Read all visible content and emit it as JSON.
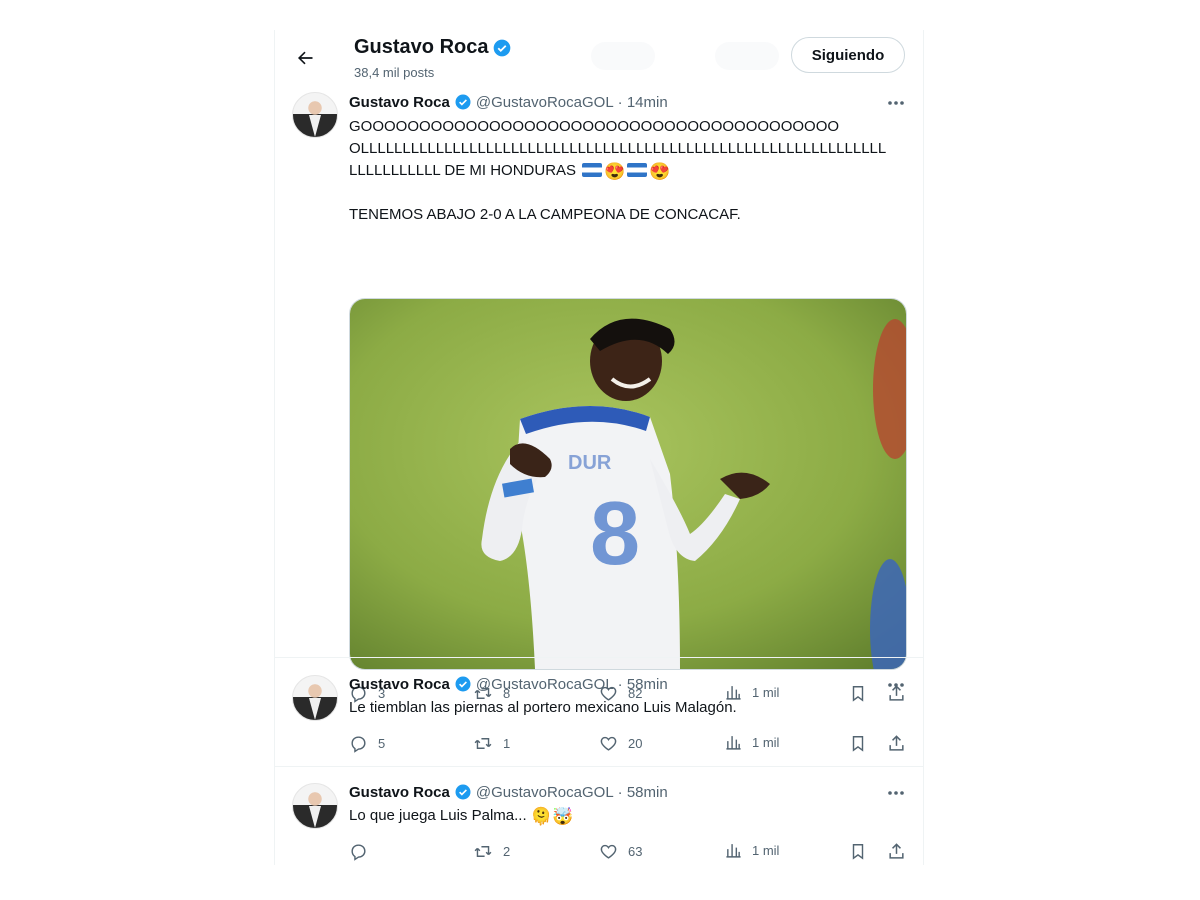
{
  "header": {
    "title": "Gustavo Roca",
    "subtitle": "38,4 mil posts",
    "follow_label": "Siguiendo"
  },
  "colors": {
    "accent": "#1d9bf0",
    "text_secondary": "#536471",
    "honduras_blue": "#2f74c7",
    "pitch_green": "#8fb54a"
  },
  "tweets": [
    {
      "name": "Gustavo Roca",
      "handle": "@GustavoRocaGOL",
      "time": "· 14min",
      "lines": [
        "GOOOOOOOOOOOOOOOOOOOOOOOOOOOOOOOOOOOOOOOOO",
        "OLLLLLLLLLLLLLLLLLLLLLLLLLLLLLLLLLLLLLLLLLLLLLLLLLLLLLLLLLLLLLLL",
        "LLLLLLLLLLL DE MI HONDURAS",
        "",
        "TENEMOS ABAJO 2-0 A LA CAMPEONA DE CONCACAF."
      ],
      "emojis": [
        "🇭🇳",
        "😍",
        "🇭🇳",
        "😍"
      ],
      "media_description": "Jugador de Honduras número 8 celebrando",
      "replies": "3",
      "reposts": "8",
      "likes": "82",
      "views": "1 mil"
    },
    {
      "name": "Gustavo Roca",
      "handle": "@GustavoRocaGOL",
      "time": "· 58min",
      "lines": [
        "Le tiemblan las piernas al portero mexicano Luis Malagón."
      ],
      "replies": "5",
      "reposts": "1",
      "likes": "20",
      "views": "1 mil"
    },
    {
      "name": "Gustavo Roca",
      "handle": "@GustavoRocaGOL",
      "time": "· 58min",
      "lines": [
        "Lo que juega Luis Palma..."
      ],
      "emojis": [
        "🫠",
        "🤯"
      ],
      "replies": "",
      "reposts": "2",
      "likes": "63",
      "views": "1 mil"
    }
  ],
  "icons": {
    "back": "arrow-left-icon",
    "verified": "verified-badge-icon",
    "more": "more-dots-icon",
    "reply": "reply-icon",
    "repost": "repost-icon",
    "like": "heart-icon",
    "views": "views-chart-icon",
    "bookmark": "bookmark-icon",
    "share": "share-icon"
  }
}
